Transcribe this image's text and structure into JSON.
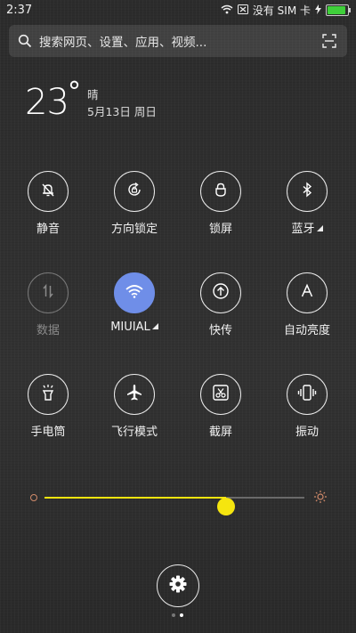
{
  "status": {
    "time": "2:37",
    "carrier": "没有 SIM 卡",
    "battery_level": 0.9,
    "battery_color": "#3fcf3a"
  },
  "search": {
    "placeholder": "搜索网页、设置、应用、视频..."
  },
  "weather": {
    "temperature": "23",
    "degree_symbol": "°",
    "condition": "晴",
    "date": "5月13日 周日"
  },
  "toggles": [
    {
      "label": "静音",
      "icon": "bell-off-icon",
      "state": "off"
    },
    {
      "label": "方向锁定",
      "icon": "rotation-lock-icon",
      "state": "off"
    },
    {
      "label": "锁屏",
      "icon": "lock-icon",
      "state": "off"
    },
    {
      "label": "蓝牙",
      "icon": "bluetooth-icon",
      "state": "off"
    },
    {
      "label": "数据",
      "icon": "mobile-data-icon",
      "state": "disabled"
    },
    {
      "label": "MIUIAL",
      "icon": "wifi-icon",
      "state": "on"
    },
    {
      "label": "快传",
      "icon": "quick-transfer-icon",
      "state": "off"
    },
    {
      "label": "自动亮度",
      "icon": "auto-brightness-icon",
      "state": "off"
    },
    {
      "label": "手电筒",
      "icon": "flashlight-icon",
      "state": "off"
    },
    {
      "label": "飞行模式",
      "icon": "airplane-icon",
      "state": "off"
    },
    {
      "label": "截屏",
      "icon": "screenshot-icon",
      "state": "off"
    },
    {
      "label": "振动",
      "icon": "vibrate-icon",
      "state": "off"
    }
  ],
  "brightness": {
    "level": 0.7,
    "accent_color": "#f5e50f"
  },
  "active_color": "#6f8ee8",
  "pager": {
    "count": 2,
    "current": 2
  }
}
